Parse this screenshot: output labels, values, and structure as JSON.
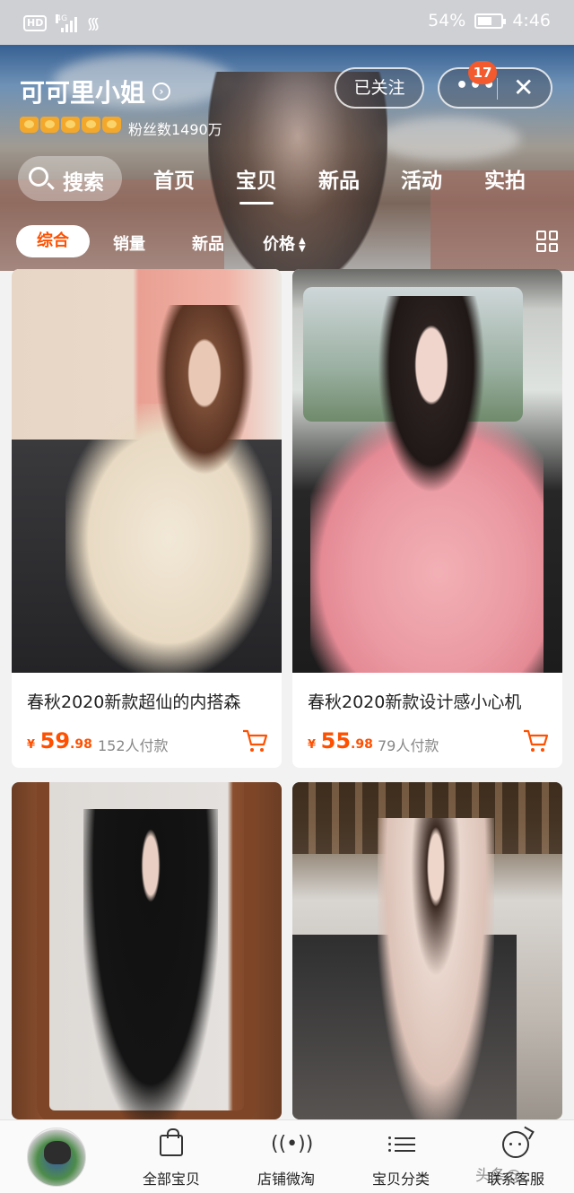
{
  "status_bar": {
    "hd": "HD",
    "network": "4G",
    "battery_percent": "54%",
    "battery_level": 0.54,
    "time": "4:46"
  },
  "shop": {
    "name": "可可里小姐",
    "crown_count": 5,
    "fans": "粉丝数1490万",
    "follow_label": "已关注",
    "more_badge": "17"
  },
  "nav": {
    "search_label": "搜索",
    "tabs": [
      "首页",
      "宝贝",
      "新品",
      "活动",
      "实拍"
    ],
    "active_tab": "宝贝"
  },
  "sort": {
    "items": [
      "综合",
      "销量",
      "新品",
      "价格"
    ],
    "active": "综合"
  },
  "products": [
    {
      "title": "春秋2020新款超仙的内搭森",
      "yen": "¥",
      "price_int": "59",
      "price_dec": ".98",
      "sales": "152人付款",
      "image_desc": "woman in cream lace dress on sofa"
    },
    {
      "title": "春秋2020新款设计感小心机",
      "yen": "¥",
      "price_int": "55",
      "price_dec": ".98",
      "sales": "79人付款",
      "image_desc": "woman in pink floral off-shoulder dress in car"
    },
    {
      "title": "",
      "image_desc": "woman in black dress mirror selfie"
    },
    {
      "title": "",
      "image_desc": "woman in floral long dress in cafe"
    }
  ],
  "tabbar": {
    "items": [
      "全部宝贝",
      "店铺微淘",
      "宝贝分类",
      "联系客服"
    ],
    "icons": [
      "bag-icon",
      "broadcast-icon",
      "list-icon",
      "service-face-icon"
    ]
  },
  "watermark": "头条@..."
}
